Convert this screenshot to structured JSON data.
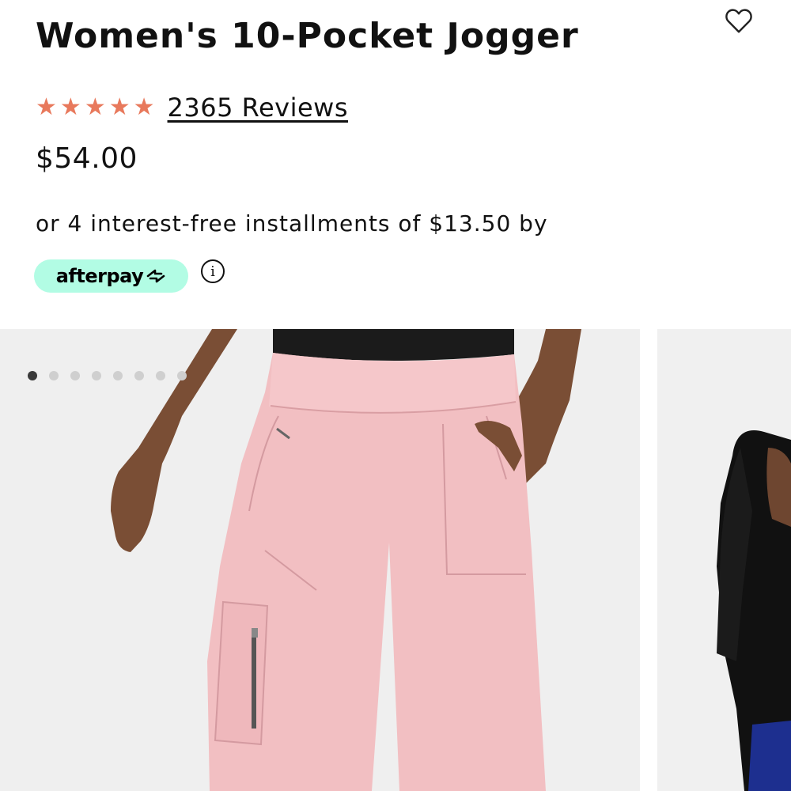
{
  "product": {
    "title": "Women's 10-Pocket Jogger",
    "rating": 5,
    "rating_max": 5,
    "reviews_label": "2365 Reviews",
    "price": "$54.00"
  },
  "installments": {
    "text": "or 4 interest-free installments of $13.50 by",
    "provider": "afterpay"
  },
  "gallery": {
    "dot_count": 8,
    "active_index": 0
  },
  "icons": {
    "favorite": "heart-outline-icon",
    "info": "info-icon",
    "star": "star-icon"
  },
  "colors": {
    "star": "#e8795c",
    "afterpay_bg": "#b2fce4",
    "pants": "#f2bfc2",
    "photo_bg": "#efefef"
  }
}
